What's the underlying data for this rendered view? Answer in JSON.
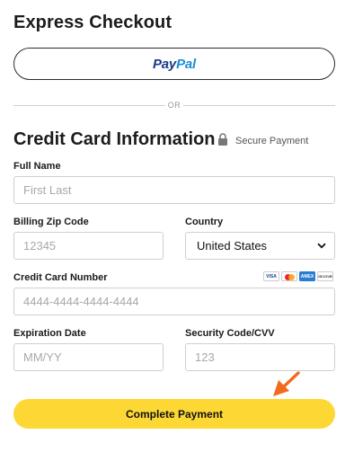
{
  "express": {
    "title": "Express Checkout",
    "paypal_pay": "Pay",
    "paypal_pal": "Pal"
  },
  "divider": {
    "text": "OR"
  },
  "credit_card": {
    "title": "Credit Card Information",
    "secure_text": "Secure Payment",
    "icons": {
      "lock": "lock-icon"
    }
  },
  "fields": {
    "full_name": {
      "label": "Full Name",
      "placeholder": "First Last",
      "value": ""
    },
    "billing_zip": {
      "label": "Billing Zip Code",
      "placeholder": "12345",
      "value": ""
    },
    "country": {
      "label": "Country",
      "value": "United States"
    },
    "card_number": {
      "label": "Credit Card Number",
      "placeholder": "4444-4444-4444-4444",
      "value": ""
    },
    "expiration": {
      "label": "Expiration Date",
      "placeholder": "MM/YY",
      "value": ""
    },
    "cvv": {
      "label": "Security Code/CVV",
      "placeholder": "123",
      "value": ""
    }
  },
  "card_logos": [
    {
      "name": "visa-logo",
      "text": "VISA"
    },
    {
      "name": "mastercard-logo",
      "text": ""
    },
    {
      "name": "amex-logo",
      "text": "AMEX"
    },
    {
      "name": "discover-logo",
      "text": "DISCOVER"
    }
  ],
  "submit": {
    "label": "Complete Payment"
  },
  "colors": {
    "accent_yellow": "#fdd835",
    "paypal_dark": "#1b3a8a",
    "paypal_light": "#1a8fd6",
    "annotation_arrow": "#f26a1b"
  }
}
